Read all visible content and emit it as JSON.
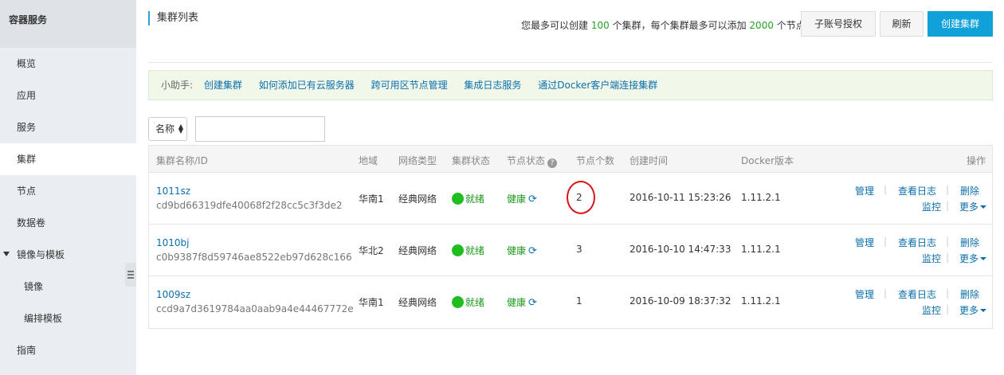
{
  "sidebar": {
    "title": "容器服务",
    "items": [
      {
        "label": "概览"
      },
      {
        "label": "应用"
      },
      {
        "label": "服务"
      },
      {
        "label": "集群"
      },
      {
        "label": "节点"
      },
      {
        "label": "数据卷"
      },
      {
        "label": "镜像与模板"
      },
      {
        "label": "镜像"
      },
      {
        "label": "编排模板"
      },
      {
        "label": "指南"
      }
    ]
  },
  "header": {
    "title": "集群列表",
    "quota_prefix": "您最多可以创建",
    "quota_clusters": "100",
    "quota_middle": "个集群，每个集群最多可以添加",
    "quota_nodes": "2000",
    "quota_suffix": "个节点",
    "btn_subaccount": "子账号授权",
    "btn_refresh": "刷新",
    "btn_create": "创建集群"
  },
  "helper": {
    "label": "小助手:",
    "links": [
      "创建集群",
      "如何添加已有云服务器",
      "跨可用区节点管理",
      "集成日志服务",
      "通过Docker客户端连接集群"
    ]
  },
  "filter": {
    "select_value": "名称",
    "input_value": ""
  },
  "table": {
    "columns": [
      "集群名称/ID",
      "地域",
      "网络类型",
      "集群状态",
      "节点状态",
      "节点个数",
      "创建时间",
      "Docker版本",
      "操作"
    ],
    "rows": [
      {
        "name": "1011sz",
        "id": "cd9bd66319dfe40068f2f28cc5c3f3de2",
        "region": "华南1",
        "network": "经典网络",
        "status": "就绪",
        "node_status": "健康",
        "node_count": "2",
        "created": "2016-10-11 15:23:26",
        "docker": "1.11.2.1"
      },
      {
        "name": "1010bj",
        "id": "c0b9387f8d59746ae8522eb97d628c166",
        "region": "华北2",
        "network": "经典网络",
        "status": "就绪",
        "node_status": "健康",
        "node_count": "3",
        "created": "2016-10-10 14:47:33",
        "docker": "1.11.2.1"
      },
      {
        "name": "1009sz",
        "id": "ccd9a7d3619784aa0aab9a4e44467772e",
        "region": "华南1",
        "network": "经典网络",
        "status": "就绪",
        "node_status": "健康",
        "node_count": "1",
        "created": "2016-10-09 18:37:32",
        "docker": "1.11.2.1"
      }
    ],
    "actions": {
      "manage": "管理",
      "logs": "查看日志",
      "delete": "删除",
      "monitor": "监控",
      "more": "更多"
    }
  },
  "colors": {
    "accent": "#0fa1d8",
    "link": "#0b6ead",
    "success": "#1fbe1f",
    "annotation": "#d8151a"
  }
}
